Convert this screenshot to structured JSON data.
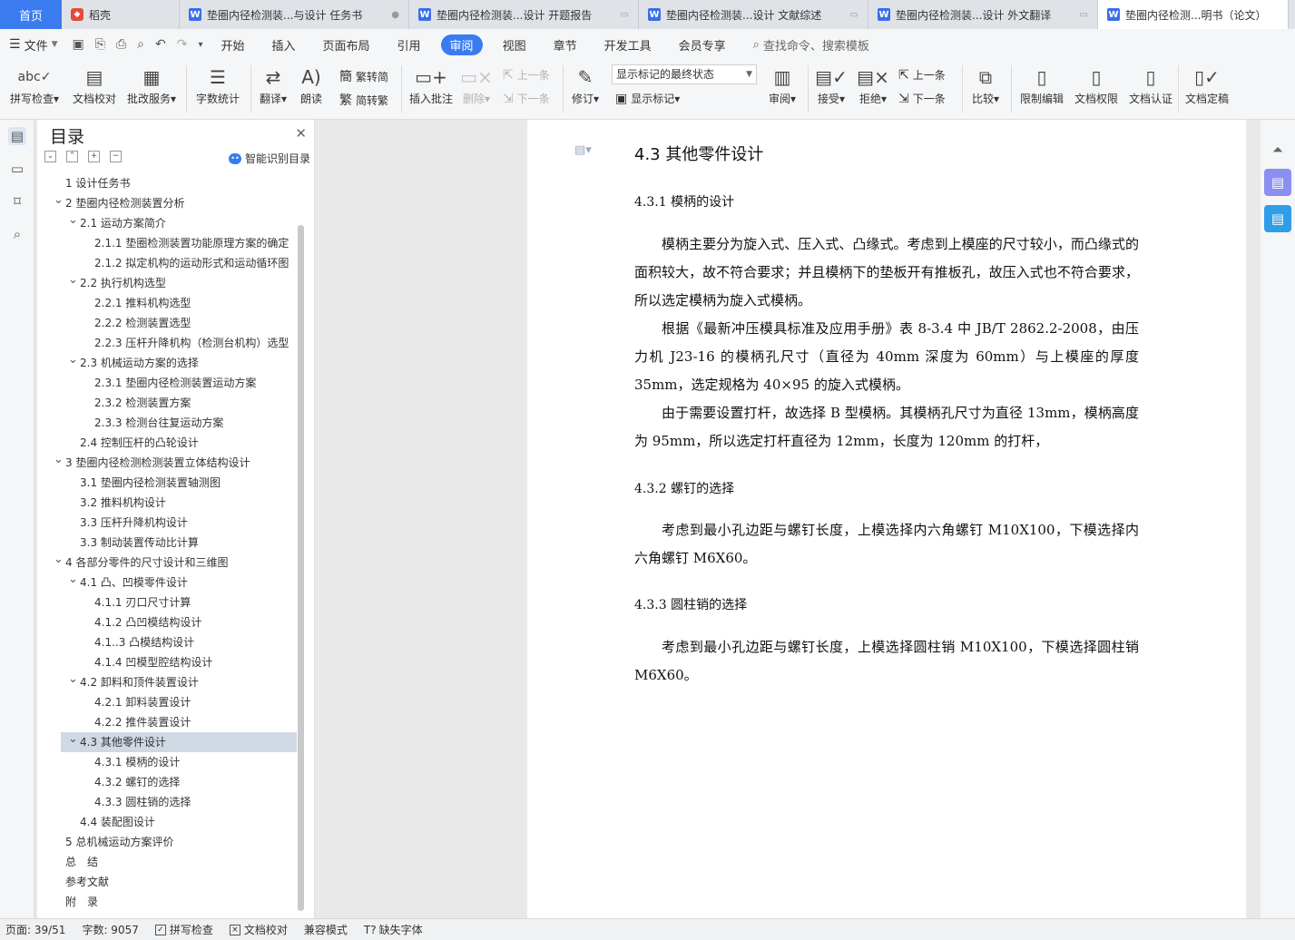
{
  "tabs": {
    "home": "首页",
    "shell": "稻壳",
    "docs": [
      {
        "title": "垫圈内径检测装...与设计 任务书",
        "active": false
      },
      {
        "title": "垫圈内径检测装...设计 开题报告",
        "active": false
      },
      {
        "title": "垫圈内径检测装...设计 文献综述",
        "active": false
      },
      {
        "title": "垫圈内径检测装...设计 外文翻译",
        "active": false
      },
      {
        "title": "垫圈内径检测...明书（论文）",
        "active": true
      }
    ]
  },
  "menubar": {
    "file": "文件",
    "tabs": [
      "开始",
      "插入",
      "页面布局",
      "引用",
      "审阅",
      "视图",
      "章节",
      "开发工具",
      "会员专享"
    ],
    "active_tab": "审阅",
    "search": "查找命令、搜索模板"
  },
  "ribbon": {
    "spell_check": "拼写检查",
    "doc_check": "文档校对",
    "annotate_service": "批改服务",
    "word_count": "字数统计",
    "translate": "翻译",
    "read_aloud": "朗读",
    "trad_to_simp": "繁转简",
    "simp_to_trad": "简转繁",
    "insert_comment": "插入批注",
    "delete": "删除",
    "prev_comment": "上一条",
    "next_comment": "下一条",
    "revise": "修订",
    "markup_state": "显示标记的最终状态",
    "show_markup": "显示标记",
    "review": "审阅",
    "accept": "接受",
    "reject": "拒绝",
    "prev_change": "上一条",
    "next_change": "下一条",
    "compare": "比较",
    "restrict_edit": "限制编辑",
    "doc_permission": "文档权限",
    "doc_certify": "文档认证",
    "doc_finalize": "文档定稿"
  },
  "toc": {
    "title": "目录",
    "smart": "智能识别目录",
    "items": [
      {
        "text": "1 设计任务书",
        "level": 0,
        "arrow": ""
      },
      {
        "text": "2 垫圈内径检测装置分析",
        "level": 0,
        "arrow": "v"
      },
      {
        "text": "2.1 运动方案简介",
        "level": 1,
        "arrow": "v"
      },
      {
        "text": "2.1.1 垫圈检测装置功能原理方案的确定",
        "level": 2,
        "arrow": ""
      },
      {
        "text": "2.1.2 拟定机构的运动形式和运动循环图",
        "level": 2,
        "arrow": ""
      },
      {
        "text": "2.2 执行机构选型",
        "level": 1,
        "arrow": "v"
      },
      {
        "text": "2.2.1 推料机构选型",
        "level": 2,
        "arrow": ""
      },
      {
        "text": "2.2.2 检测装置选型",
        "level": 2,
        "arrow": ""
      },
      {
        "text": "2.2.3 压杆升降机构（检测台机构）选型",
        "level": 2,
        "arrow": ""
      },
      {
        "text": "2.3 机械运动方案的选择",
        "level": 1,
        "arrow": "v"
      },
      {
        "text": "2.3.1 垫圈内径检测装置运动方案",
        "level": 2,
        "arrow": ""
      },
      {
        "text": "2.3.2 检测装置方案",
        "level": 2,
        "arrow": ""
      },
      {
        "text": "2.3.3 检测台往复运动方案",
        "level": 2,
        "arrow": ""
      },
      {
        "text": "2.4 控制压杆的凸轮设计",
        "level": 1,
        "arrow": ""
      },
      {
        "text": "3 垫圈内径检测检测装置立体结构设计",
        "level": 0,
        "arrow": "v"
      },
      {
        "text": "3.1 垫圈内径检测装置轴测图",
        "level": 1,
        "arrow": ""
      },
      {
        "text": "3.2 推料机构设计",
        "level": 1,
        "arrow": ""
      },
      {
        "text": "3.3 压杆升降机构设计",
        "level": 1,
        "arrow": ""
      },
      {
        "text": "3.3 制动装置传动比计算",
        "level": 1,
        "arrow": ""
      },
      {
        "text": "4 各部分零件的尺寸设计和三维图",
        "level": 0,
        "arrow": "v"
      },
      {
        "text": "4.1 凸、凹模零件设计",
        "level": 1,
        "arrow": "v"
      },
      {
        "text": "4.1.1 刃口尺寸计算",
        "level": 2,
        "arrow": ""
      },
      {
        "text": "4.1.2 凸凹模结构设计",
        "level": 2,
        "arrow": ""
      },
      {
        "text": "4.1..3 凸模结构设计",
        "level": 2,
        "arrow": ""
      },
      {
        "text": "4.1.4 凹模型腔结构设计",
        "level": 2,
        "arrow": ""
      },
      {
        "text": "4.2 卸料和顶件装置设计",
        "level": 1,
        "arrow": "v"
      },
      {
        "text": "4.2.1 卸料装置设计",
        "level": 2,
        "arrow": ""
      },
      {
        "text": "4.2.2 推件装置设计",
        "level": 2,
        "arrow": ""
      },
      {
        "text": "4.3 其他零件设计",
        "level": 1,
        "arrow": "v",
        "selected": true
      },
      {
        "text": "4.3.1 模柄的设计",
        "level": 2,
        "arrow": ""
      },
      {
        "text": "4.3.2 螺钉的选择",
        "level": 2,
        "arrow": ""
      },
      {
        "text": "4.3.3 圆柱销的选择",
        "level": 2,
        "arrow": ""
      },
      {
        "text": "4.4 装配图设计",
        "level": 1,
        "arrow": ""
      },
      {
        "text": "5 总机械运动方案评价",
        "level": 0,
        "arrow": ""
      },
      {
        "text": "总　结",
        "level": 0,
        "arrow": ""
      },
      {
        "text": "参考文献",
        "level": 0,
        "arrow": ""
      },
      {
        "text": "附　录",
        "level": 0,
        "arrow": ""
      }
    ]
  },
  "document": {
    "section_title": "4.3 其他零件设计",
    "s1_title": "4.3.1 模柄的设计",
    "s1_p1": "模柄主要分为旋入式、压入式、凸缘式。考虑到上模座的尺寸较小，而凸缘式的面积较大，故不符合要求；并且模柄下的垫板开有推板孔，故压入式也不符合要求，所以选定模柄为旋入式模柄。",
    "s1_p2": "根据《最新冲压模具标准及应用手册》表 8-3.4 中 JB/T 2862.2-2008，由压力机 J23-16 的模柄孔尺寸（直径为 40mm 深度为 60mm）与上模座的厚度 35mm，选定规格为 40×95 的旋入式模柄。",
    "s1_p3": "由于需要设置打杆，故选择 B 型模柄。其模柄孔尺寸为直径 13mm，模柄高度为 95mm，所以选定打杆直径为 12mm，长度为 120mm 的打杆，",
    "s2_title": "4.3.2 螺钉的选择",
    "s2_p1": "考虑到最小孔边距与螺钉长度，上模选择内六角螺钉 M10X100，下模选择内六角螺钉 M6X60。",
    "s3_title": "4.3.3 圆柱销的选择",
    "s3_p1": "考虑到最小孔边距与螺钉长度，上模选择圆柱销 M10X100，下模选择圆柱销 M6X60。"
  },
  "status": {
    "page": "页面: 39/51",
    "words": "字数: 9057",
    "spell": "拼写检查",
    "proof": "文档校对",
    "compat": "兼容模式",
    "missing_font": "缺失字体"
  }
}
